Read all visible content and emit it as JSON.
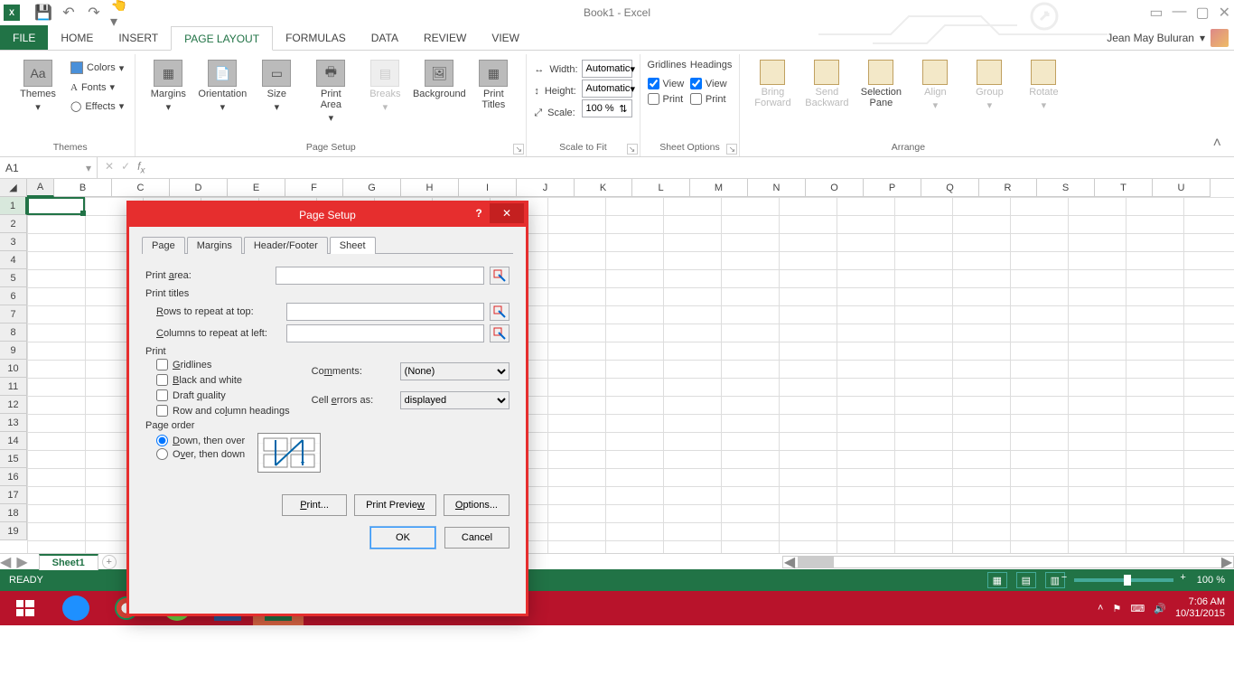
{
  "titlebar": {
    "title": "Book1 - Excel"
  },
  "tabs": {
    "file": "FILE",
    "home": "HOME",
    "insert": "INSERT",
    "pagelayout": "PAGE LAYOUT",
    "formulas": "FORMULAS",
    "data": "DATA",
    "review": "REVIEW",
    "view": "VIEW"
  },
  "user": {
    "name": "Jean May Buluran"
  },
  "ribbon": {
    "themes": {
      "label": "Themes",
      "btn": "Themes",
      "colors": "Colors",
      "fonts": "Fonts",
      "effects": "Effects"
    },
    "pagesetup": {
      "label": "Page Setup",
      "margins": "Margins",
      "orientation": "Orientation",
      "size": "Size",
      "printarea": "Print\nArea",
      "breaks": "Breaks",
      "background": "Background",
      "printtitles": "Print\nTitles"
    },
    "scale": {
      "label": "Scale to Fit",
      "width": "Width:",
      "height": "Height:",
      "scale": "Scale:",
      "widthval": "Automatic",
      "heightval": "Automatic",
      "scaleval": "100 %"
    },
    "sheetopt": {
      "label": "Sheet Options",
      "gridlines": "Gridlines",
      "headings": "Headings",
      "view": "View",
      "print": "Print"
    },
    "arrange": {
      "label": "Arrange",
      "bringfwd": "Bring\nForward",
      "sendback": "Send\nBackward",
      "selpane": "Selection\nPane",
      "align": "Align",
      "group": "Group",
      "rotate": "Rotate"
    }
  },
  "formula": {
    "cell": "A1"
  },
  "cols": [
    "A",
    "B",
    "C",
    "D",
    "E",
    "F",
    "G",
    "H",
    "I",
    "J",
    "K",
    "L",
    "M",
    "N",
    "O",
    "P",
    "Q",
    "R",
    "S",
    "T",
    "U"
  ],
  "rows": [
    "1",
    "2",
    "3",
    "4",
    "5",
    "6",
    "7",
    "8",
    "9",
    "10",
    "11",
    "12",
    "13",
    "14",
    "15",
    "16",
    "17",
    "18",
    "19"
  ],
  "sheet": {
    "tab": "Sheet1"
  },
  "status": {
    "ready": "READY",
    "zoom": "100 %"
  },
  "clock": {
    "time": "7:06 AM",
    "date": "10/31/2015"
  },
  "dialog": {
    "title": "Page Setup",
    "tabs": {
      "page": "Page",
      "margins": "Margins",
      "headerfooter": "Header/Footer",
      "sheet": "Sheet"
    },
    "printarea": "Print area:",
    "printtitles": "Print titles",
    "rowsrepeat": "Rows to repeat at top:",
    "colsrepeat": "Columns to repeat at left:",
    "print": "Print",
    "gridlines": "Gridlines",
    "bw": "Black and white",
    "draft": "Draft quality",
    "rowcolhead": "Row and column headings",
    "comments": "Comments:",
    "commentsval": "(None)",
    "cellerrors": "Cell errors as:",
    "cellerrorsval": "displayed",
    "pageorder": "Page order",
    "downover": "Down, then over",
    "overdown": "Over, then down",
    "printbtn": "Print...",
    "previewbtn": "Print Preview",
    "optionsbtn": "Options...",
    "ok": "OK",
    "cancel": "Cancel"
  }
}
